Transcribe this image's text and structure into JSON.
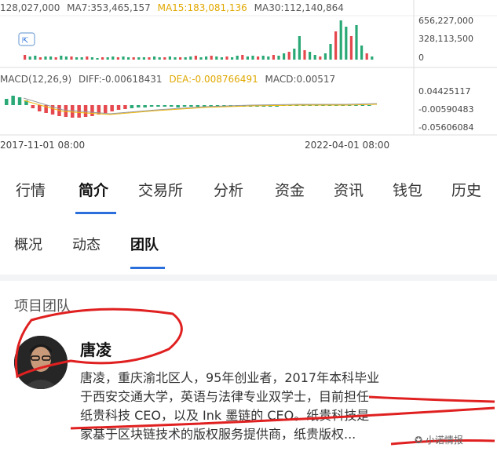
{
  "chart": {
    "volume_legend": {
      "vol": "128,027,000",
      "ma7": "MA7:353,465,157",
      "ma15": "MA15:183,081,136",
      "ma30": "MA30:112,140,864"
    },
    "volume_axis": [
      "656,227,000",
      "328,113,500",
      "0"
    ],
    "macd_legend": {
      "params": "MACD(12,26,9)",
      "diff": "DIFF:-0.00618431",
      "dea": "DEA:-0.008766491",
      "macd": "MACD:0.00517"
    },
    "macd_axis": [
      "0.04425117",
      "-0.00590483",
      "-0.05606084"
    ],
    "time_axis": [
      "2017-11-01 08:00",
      "2022-04-01 08:00"
    ],
    "colors": {
      "up": "#2aa876",
      "down": "#e5484d",
      "ma7": "#999999",
      "ma15": "#f0b90b",
      "ma30": "#d63384",
      "dea": "#f0b90b",
      "accent": "#2a6fdb",
      "annotation": "#e02020"
    }
  },
  "main_tabs": [
    "行情",
    "简介",
    "交易所",
    "分析",
    "资金",
    "资讯",
    "钱包",
    "历史"
  ],
  "main_tab_active": "简介",
  "sub_tabs": [
    "概况",
    "动态",
    "团队"
  ],
  "sub_tab_active": "团队",
  "team": {
    "section_title": "项目团队",
    "member": {
      "name": "唐凌",
      "bio_lines": [
        "唐凌，重庆渝北区人，95年创业者，2017年本科毕业",
        "于西安交通大学，英语与法律专业双学士，目前担任",
        "纸贵科技 CEO，以及 Ink 墨链的 CEO。纸贵科技是",
        "家基于区块链技术的版权服务提供商，纸贵版权..."
      ]
    }
  },
  "watermark": "小诺情报"
}
